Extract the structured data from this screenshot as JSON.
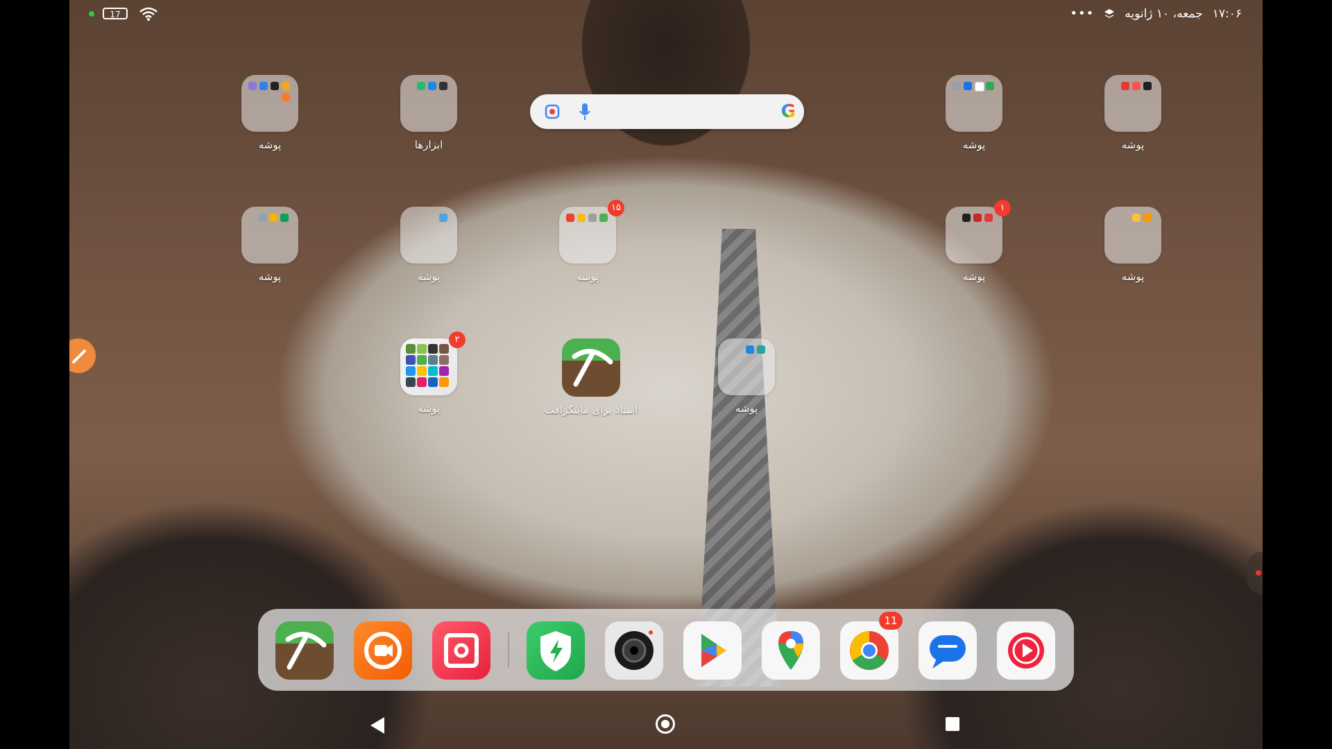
{
  "status": {
    "battery": "17",
    "time": "۱۷:۰۶",
    "date": "جمعه، ۱۰ ژانویه",
    "more": "•••"
  },
  "search": {
    "placeholder": "",
    "brand": "G"
  },
  "folders": [
    {
      "label": "پوشه",
      "badge": ""
    },
    {
      "label": "ابزارها",
      "badge": ""
    },
    {
      "label": "پوشه",
      "badge": ""
    },
    {
      "label": "پوشه",
      "badge": ""
    },
    {
      "label": "پوشه",
      "badge": ""
    },
    {
      "label": "پوشه",
      "badge": ""
    },
    {
      "label": "پوشه",
      "badge": "۱۵"
    },
    {
      "label": "پوشه",
      "badge": "۱"
    },
    {
      "label": "پوشه",
      "badge": ""
    },
    {
      "label": "پوشه",
      "badge": "۲"
    },
    {
      "label": "پوشه",
      "badge": ""
    }
  ],
  "apps": {
    "minecraft_label": "استاد برای ماینکرافت"
  },
  "dock": {
    "chrome_badge": "11",
    "icons": [
      "minecraft-master-icon",
      "screen-recorder-icon",
      "screenshot-icon",
      "security-icon",
      "camera-icon",
      "play-store-icon",
      "maps-icon",
      "chrome-icon",
      "messages-icon",
      "music-icon"
    ]
  },
  "colors": {
    "badge": "#f23b2f",
    "dock_bg": "#ebebeb"
  }
}
